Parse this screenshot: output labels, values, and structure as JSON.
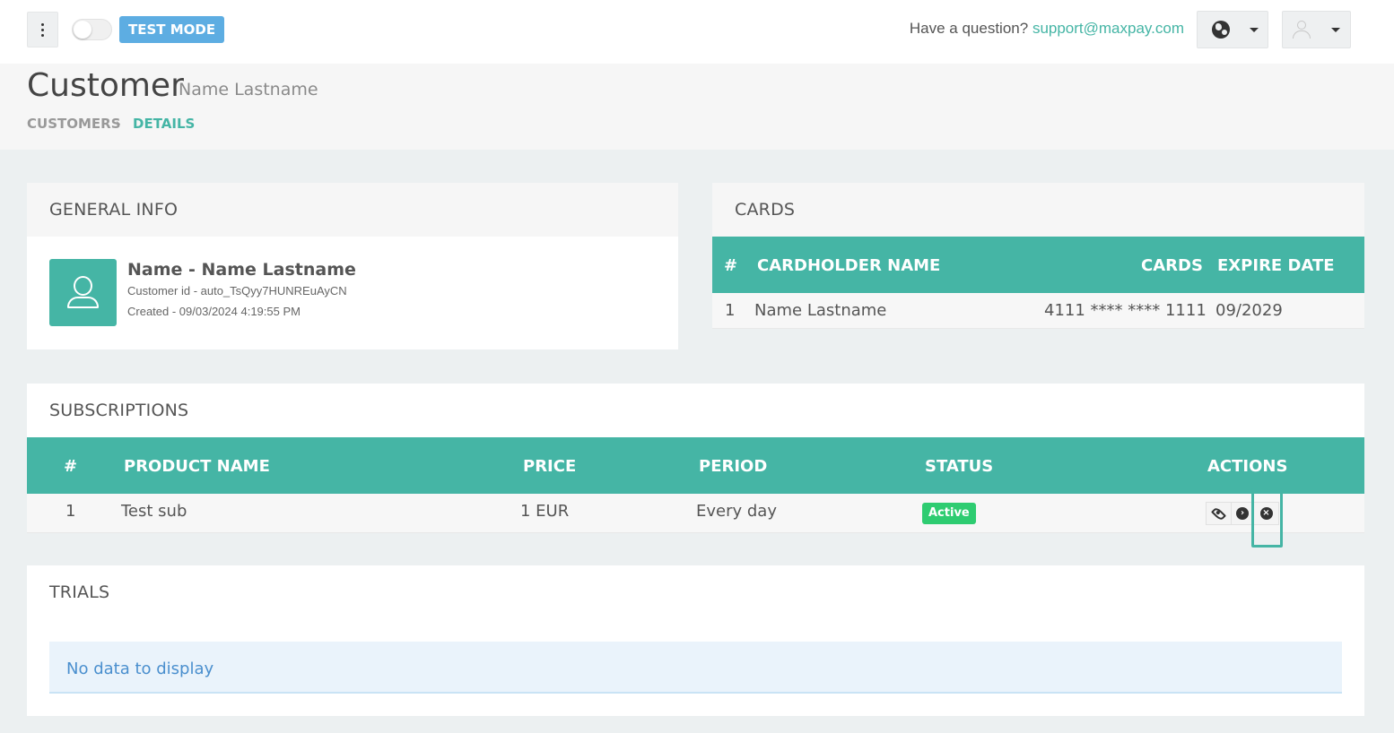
{
  "topbar": {
    "test_mode_label": "TEST MODE",
    "question_text": "Have a question?",
    "support_email": "support@maxpay.com"
  },
  "page": {
    "title": "Customer",
    "subtitle": "Name Lastname",
    "breadcrumb": [
      "CUSTOMERS",
      "DETAILS"
    ],
    "breadcrumb_separator": "›"
  },
  "general_info": {
    "title": "GENERAL INFO",
    "name": "Name - Name Lastname",
    "customer_id": "Customer id - auto_TsQyy7HUNREuAyCN",
    "created": "Created - 09/03/2024 4:19:55 PM"
  },
  "cards": {
    "title": "CARDS",
    "columns": [
      "#",
      "CARDHOLDER NAME",
      "CARDS",
      "EXPIRE DATE"
    ],
    "rows": [
      {
        "num": "1",
        "holder": "Name Lastname",
        "card": "4111 **** **** 1111",
        "expire": "09/2029"
      }
    ]
  },
  "subscriptions": {
    "title": "SUBSCRIPTIONS",
    "columns": [
      "#",
      "PRODUCT NAME",
      "PRICE",
      "PERIOD",
      "STATUS",
      "ACTIONS"
    ],
    "rows": [
      {
        "num": "1",
        "product": "Test sub",
        "price": "1 EUR",
        "period": "Every day",
        "status": "Active"
      }
    ]
  },
  "trials": {
    "title": "TRIALS",
    "empty_text": "No data to display"
  },
  "colors": {
    "accent": "#45b5a5",
    "test_badge": "#5dade2",
    "status_active": "#2ecc71",
    "nodata_text": "#4a8fce"
  },
  "icons": [
    "vertical-dots-icon",
    "globe-icon",
    "user-icon",
    "caret-down-icon",
    "eye-icon",
    "arrow-right-circle-icon",
    "close-circle-icon"
  ]
}
